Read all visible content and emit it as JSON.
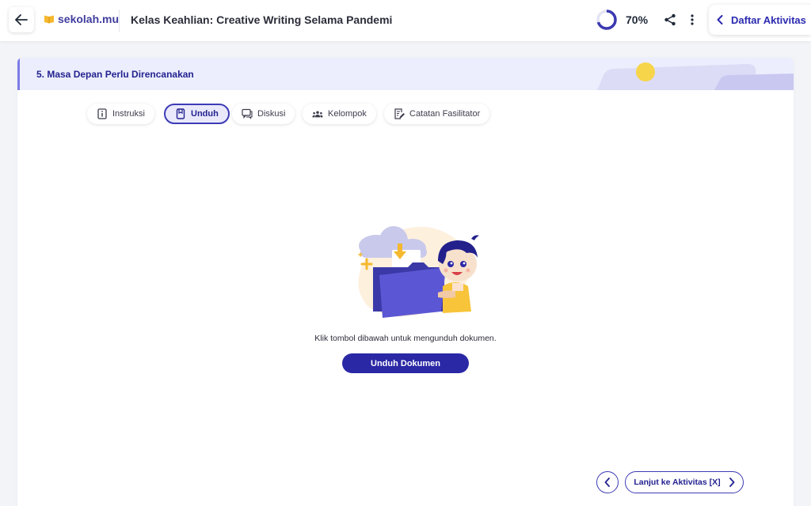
{
  "header": {
    "logo_text": "sekolah.mu",
    "course_title": "Kelas Keahlian: Creative Writing Selama Pandemi",
    "progress_percent": 70,
    "progress_label": "70%",
    "activity_list_label": "Daftar Aktivitas"
  },
  "icons": {
    "back": "arrow-left-icon",
    "logo": "book-logo-icon",
    "share": "share-icon",
    "more": "more-vertical-icon",
    "activity_list": "chevron-left-icon"
  },
  "activity": {
    "title": "5. Masa Depan Perlu Direncanakan"
  },
  "tabs": [
    {
      "label": "Instruksi",
      "icon": "info-icon",
      "active": false
    },
    {
      "label": "Unduh",
      "icon": "document-icon",
      "active": true
    },
    {
      "label": "Diskusi",
      "icon": "chat-icon",
      "active": false
    },
    {
      "label": "Kelompok",
      "icon": "group-icon",
      "active": false
    },
    {
      "label": "Catatan Fasilitator",
      "icon": "note-icon",
      "active": false
    }
  ],
  "download": {
    "message": "Klik tombol dibawah untuk mengunduh dokumen.",
    "button_label": "Unduh Dokumen"
  },
  "navigation": {
    "next_label": "Lanjut ke Aktivitas [X]"
  },
  "colors": {
    "primary": "#2b28a6",
    "header_bg": "#eceefd",
    "accent_yellow": "#f7d54a"
  }
}
